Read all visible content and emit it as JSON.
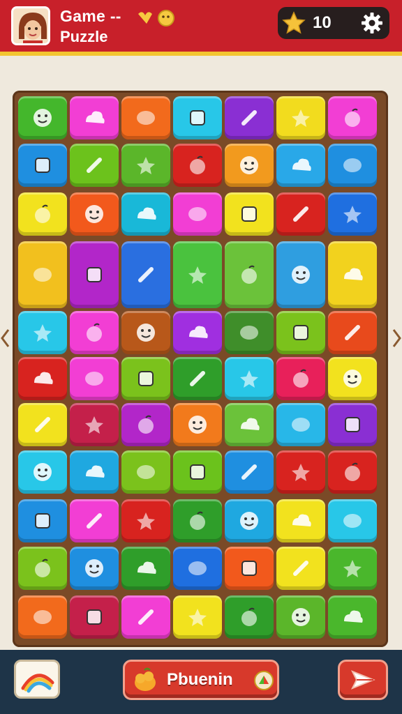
{
  "header": {
    "title_line1": "Game --",
    "title_line2": "Puzzle",
    "score": "10"
  },
  "footer": {
    "action_label": "Pbuenin"
  },
  "icons": {
    "avatar": "player-avatar",
    "star": "star-icon",
    "settings": "gear-icon",
    "hint": "rainbow-icon",
    "action": "fruit-icon",
    "share": "paper-plane-icon"
  },
  "colors": {
    "header": "#c8202a",
    "header_stripe": "#f3c531",
    "board": "#7a4a27",
    "bottom_bar": "#1e3448",
    "button": "#d7392b"
  },
  "board": {
    "columns": 7,
    "rows": 11,
    "tiles": [
      [
        "#44b72c",
        "#f23ed4",
        "#f26a1c",
        "#28c7e8",
        "#8a2fd3",
        "#f2dc1e",
        "#f23ed4"
      ],
      [
        "#1f8fe0",
        "#6cc21c",
        "#5bb62a",
        "#d8231f",
        "#f29a1e",
        "#29a8e8",
        "#1f8fe0"
      ],
      [
        "#f2e21e",
        "#f2591c",
        "#19b8d8",
        "#f23ed4",
        "#f2e21e",
        "#d8231f",
        "#1f6fe0"
      ],
      [
        "#f2c01e",
        "#b226c9",
        "#2a6fe0",
        "#4ac23e",
        "#6bc23a",
        "#2f9ee0",
        "#f2d21e"
      ],
      [
        "#28c7e8",
        "#f23ed4",
        "#b8581a",
        "#a02fe0",
        "#3f8e2a",
        "#7bc21c",
        "#e84a1c"
      ],
      [
        "#d8231f",
        "#f23ed4",
        "#7bc21c",
        "#2f9e2a",
        "#28c7e8",
        "#e8205a",
        "#f2e21e"
      ],
      [
        "#f2e21e",
        "#c4204a",
        "#b226c9",
        "#f27a1c",
        "#6bc23a",
        "#28b7e8",
        "#8a2fd3"
      ],
      [
        "#28c7e8",
        "#1fa8e0",
        "#7bc21c",
        "#6bc21c",
        "#1f8fe0",
        "#d8231f",
        "#d8231f"
      ],
      [
        "#1f8fe0",
        "#f23ed4",
        "#d8231f",
        "#2f9e2a",
        "#1fa8e0",
        "#f2e21e",
        "#28c7e8"
      ],
      [
        "#7bc21c",
        "#1f8fe0",
        "#2f9e2a",
        "#1f6fe0",
        "#f2591c",
        "#f2e21e",
        "#4ab72c"
      ],
      [
        "#f26a1c",
        "#c4204a",
        "#f23ed4",
        "#f2e21e",
        "#2f9e2a",
        "#5bb62a",
        "#4ab72c"
      ]
    ]
  }
}
